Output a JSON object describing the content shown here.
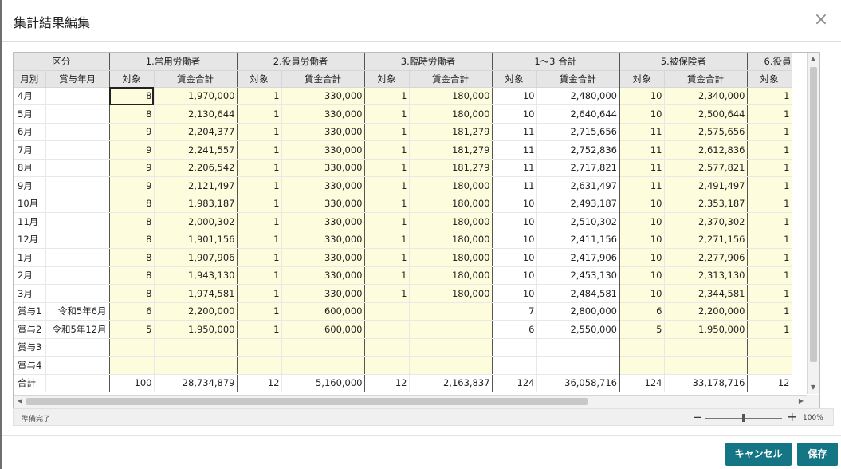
{
  "dialog": {
    "title": "集計結果編集",
    "close_icon": "×",
    "status_text": "準備完了",
    "zoom": {
      "minus": "−",
      "plus": "+",
      "value": "100%"
    },
    "buttons": {
      "cancel": "キャンセル",
      "save": "保存"
    }
  },
  "grid": {
    "corner_label": "区分",
    "sub_month": "月別",
    "sub_bonus": "賞与年月",
    "groups": [
      "1.常用労働者",
      "2.役員労働者",
      "3.臨時労働者",
      "1～3 合計",
      "5.被保険者",
      "6.役員"
    ],
    "sub_count": "対象",
    "sub_wage": "賃金合計",
    "rows": [
      {
        "label": "4月",
        "bonus": "",
        "values": [
          "8",
          "1,970,000",
          "1",
          "330,000",
          "1",
          "180,000",
          "10",
          "2,480,000",
          "10",
          "2,340,000",
          "1"
        ]
      },
      {
        "label": "5月",
        "bonus": "",
        "values": [
          "8",
          "2,130,644",
          "1",
          "330,000",
          "1",
          "180,000",
          "10",
          "2,640,644",
          "10",
          "2,500,644",
          "1"
        ]
      },
      {
        "label": "6月",
        "bonus": "",
        "values": [
          "9",
          "2,204,377",
          "1",
          "330,000",
          "1",
          "181,279",
          "11",
          "2,715,656",
          "11",
          "2,575,656",
          "1"
        ]
      },
      {
        "label": "7月",
        "bonus": "",
        "values": [
          "9",
          "2,241,557",
          "1",
          "330,000",
          "1",
          "181,279",
          "11",
          "2,752,836",
          "11",
          "2,612,836",
          "1"
        ]
      },
      {
        "label": "8月",
        "bonus": "",
        "values": [
          "9",
          "2,206,542",
          "1",
          "330,000",
          "1",
          "181,279",
          "11",
          "2,717,821",
          "11",
          "2,577,821",
          "1"
        ]
      },
      {
        "label": "9月",
        "bonus": "",
        "values": [
          "9",
          "2,121,497",
          "1",
          "330,000",
          "1",
          "180,000",
          "11",
          "2,631,497",
          "11",
          "2,491,497",
          "1"
        ]
      },
      {
        "label": "10月",
        "bonus": "",
        "values": [
          "8",
          "1,983,187",
          "1",
          "330,000",
          "1",
          "180,000",
          "10",
          "2,493,187",
          "10",
          "2,353,187",
          "1"
        ]
      },
      {
        "label": "11月",
        "bonus": "",
        "values": [
          "8",
          "2,000,302",
          "1",
          "330,000",
          "1",
          "180,000",
          "10",
          "2,510,302",
          "10",
          "2,370,302",
          "1"
        ]
      },
      {
        "label": "12月",
        "bonus": "",
        "values": [
          "8",
          "1,901,156",
          "1",
          "330,000",
          "1",
          "180,000",
          "10",
          "2,411,156",
          "10",
          "2,271,156",
          "1"
        ]
      },
      {
        "label": "1月",
        "bonus": "",
        "values": [
          "8",
          "1,907,906",
          "1",
          "330,000",
          "1",
          "180,000",
          "10",
          "2,417,906",
          "10",
          "2,277,906",
          "1"
        ]
      },
      {
        "label": "2月",
        "bonus": "",
        "values": [
          "8",
          "1,943,130",
          "1",
          "330,000",
          "1",
          "180,000",
          "10",
          "2,453,130",
          "10",
          "2,313,130",
          "1"
        ]
      },
      {
        "label": "3月",
        "bonus": "",
        "values": [
          "8",
          "1,974,581",
          "1",
          "330,000",
          "1",
          "180,000",
          "10",
          "2,484,581",
          "10",
          "2,344,581",
          "1"
        ]
      },
      {
        "label": "賞与1",
        "bonus": "令和5年6月",
        "values": [
          "6",
          "2,200,000",
          "1",
          "600,000",
          "",
          "",
          "7",
          "2,800,000",
          "6",
          "2,200,000",
          "1"
        ]
      },
      {
        "label": "賞与2",
        "bonus": "令和5年12月",
        "values": [
          "5",
          "1,950,000",
          "1",
          "600,000",
          "",
          "",
          "6",
          "2,550,000",
          "5",
          "1,950,000",
          "1"
        ]
      },
      {
        "label": "賞与3",
        "bonus": "",
        "values": [
          "",
          "",
          "",
          "",
          "",
          "",
          "",
          "",
          "",
          "",
          ""
        ]
      },
      {
        "label": "賞与4",
        "bonus": "",
        "values": [
          "",
          "",
          "",
          "",
          "",
          "",
          "",
          "",
          "",
          "",
          ""
        ]
      }
    ],
    "total": {
      "label": "合計",
      "bonus": "",
      "values": [
        "100",
        "28,734,879",
        "12",
        "5,160,000",
        "12",
        "2,163,837",
        "124",
        "36,058,716",
        "124",
        "33,178,716",
        "12"
      ]
    }
  }
}
